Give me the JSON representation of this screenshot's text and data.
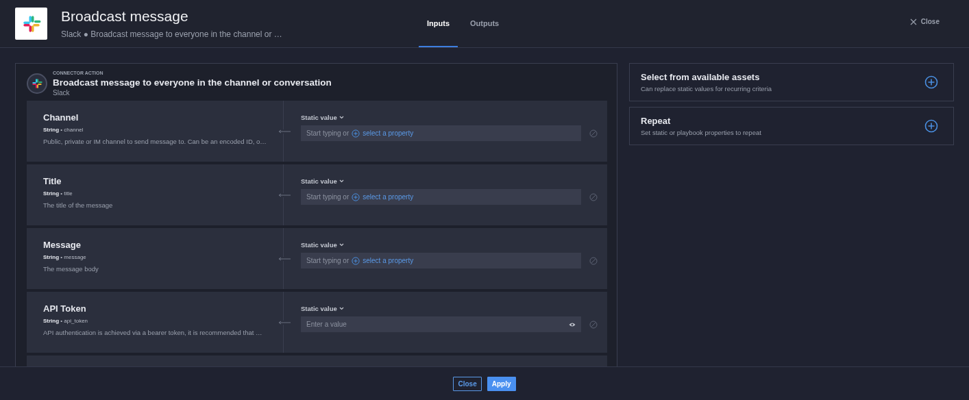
{
  "header": {
    "title": "Broadcast message",
    "subtitle": "Slack ● Broadcast message to everyone in the channel or …",
    "close_label": "Close"
  },
  "tabs": [
    {
      "label": "Inputs",
      "selected": true
    },
    {
      "label": "Outputs",
      "selected": false
    }
  ],
  "action": {
    "eyebrow": "CONNECTOR ACTION",
    "title": "Broadcast message to everyone in the channel or conversation",
    "connector": "Slack"
  },
  "fields": [
    {
      "name": "Channel",
      "meta": "**String** • channel",
      "description": "Public, private or IM channel to send message to. Can be an encoded ID, o…",
      "mode": "Static value",
      "kind": "property",
      "placeholder": "Start typing or",
      "link": "select a property"
    },
    {
      "name": "Title",
      "meta": "**String** • title",
      "description": "The title of the message",
      "mode": "Static value",
      "kind": "property",
      "placeholder": "Start typing or",
      "link": "select a property"
    },
    {
      "name": "Message",
      "meta": "**String** • message",
      "description": "The message body",
      "mode": "Static value",
      "kind": "property",
      "placeholder": "Start typing or",
      "link": "select a property"
    },
    {
      "name": "API Token",
      "meta": "**String** • api_token",
      "description": "API authentication is achieved via a bearer token, it is recommended that …",
      "mode": "Static value",
      "kind": "secret",
      "placeholder": "Enter a value"
    }
  ],
  "options": [
    {
      "title": "Select from available assets",
      "description": "Can replace static values for recurring criteria"
    },
    {
      "title": "Repeat",
      "description": "Set static or playbook properties to repeat"
    }
  ],
  "footer": {
    "buttons": [
      {
        "label": "Close",
        "kind": "secondary"
      },
      {
        "label": "Apply",
        "kind": "primary"
      }
    ]
  }
}
